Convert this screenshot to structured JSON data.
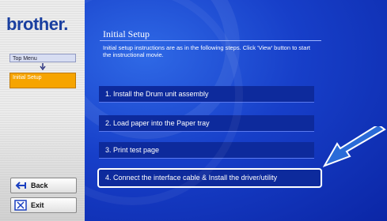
{
  "brand": {
    "name": "brother",
    "dot": "."
  },
  "sidebar": {
    "top_menu_label": "Top Menu",
    "current_label": "Initial Setup",
    "back_label": "Back",
    "exit_label": "Exit"
  },
  "main": {
    "title": "Initial Setup",
    "description": "Initial setup instructions are as in the following steps. Click 'View' button to start the instructional movie.",
    "steps": [
      {
        "label": "1. Install the Drum unit assembly"
      },
      {
        "label": "2. Load paper into the Paper tray"
      },
      {
        "label": "3. Print test page"
      },
      {
        "label": "4. Connect the interface cable & Install the driver/utility"
      }
    ]
  },
  "colors": {
    "accent_orange": "#f6a400",
    "panel_blue": "#173fc9",
    "brand_blue": "#1a3fa0",
    "arrow_blue": "#2a6bd8"
  },
  "icons": [
    "back-arrow-icon",
    "exit-icon",
    "pointer-arrow-icon",
    "down-arrow-icon"
  ]
}
